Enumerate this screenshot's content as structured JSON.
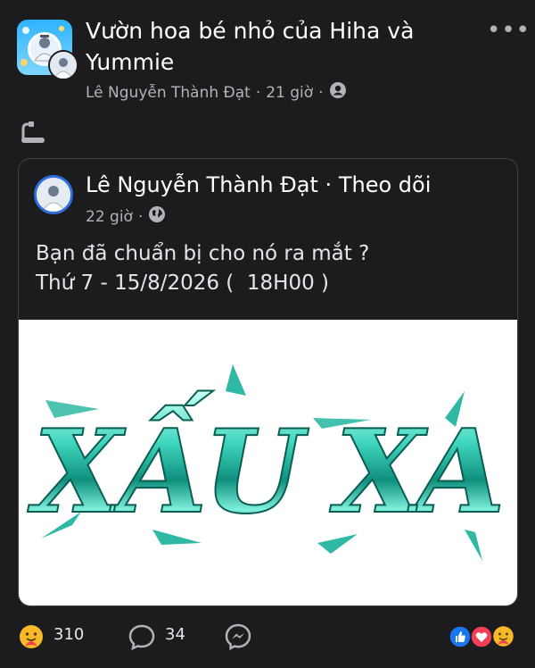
{
  "post": {
    "group_name": "Vườn hoa bé nhỏ của Hiha và Yummie",
    "author": "Lê Nguyễn Thành Đạt",
    "time": "21 giờ",
    "separator": "·",
    "more_label": "•••"
  },
  "shared": {
    "author": "Lê Nguyễn Thành Đạt",
    "separator": "·",
    "follow_label": "Theo dõi",
    "time": "22 giờ",
    "text_line1": "Bạn đã chuẩn bị cho nó ra mắt ?",
    "text_line2": "Thứ 7 - 15/8/2026 (  18H00 )",
    "image_text": "XẤU XA"
  },
  "footer": {
    "reactions_count": "310",
    "comments_count": "34"
  },
  "colors": {
    "background": "#1c1c1e",
    "text_primary": "#ffffff",
    "text_secondary": "#b0b3b8",
    "card_border": "#3e4042",
    "avatar_ring": "#2d6ee0",
    "chrome_text": "#37c9b4"
  },
  "icons": [
    "group-avatar",
    "privacy-icon",
    "globe-icon",
    "share-glyph-icon",
    "care-reaction-icon",
    "comment-icon",
    "messenger-icon",
    "like-reaction-icon",
    "love-reaction-icon"
  ]
}
